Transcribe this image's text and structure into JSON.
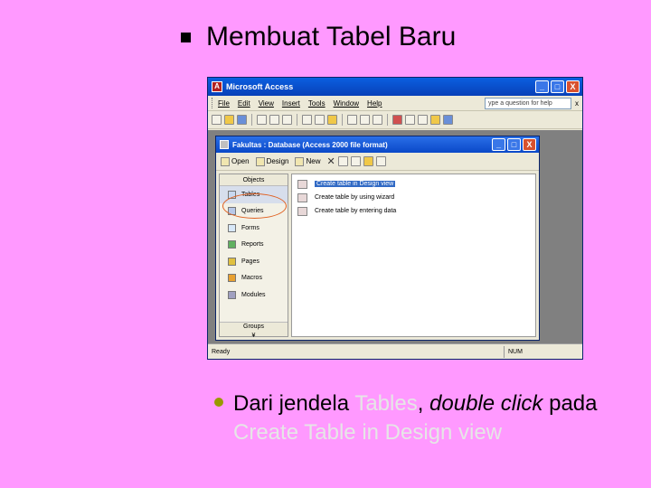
{
  "slide": {
    "title": "Membuat Tabel Baru",
    "bullet": {
      "part1": "Dari jendela ",
      "highlight1": "Tables",
      "part2": ", ",
      "italic": "double click",
      "part3": " pada ",
      "highlight2": "Create Table in Design view"
    }
  },
  "app": {
    "title": "Microsoft Access",
    "logo_letter": "A",
    "window_buttons": [
      "_",
      "□",
      "X"
    ],
    "menu": [
      "File",
      "Edit",
      "View",
      "Insert",
      "Tools",
      "Window",
      "Help"
    ],
    "help_placeholder": "ype a question for help",
    "menu_close": "x",
    "status_left": "Ready",
    "status_right": "NUM"
  },
  "db_window": {
    "title": "Fakultas : Database (Access 2000 file format)",
    "toolbar": {
      "open": "Open",
      "design": "Design",
      "new": "New"
    },
    "objects_header": "Objects",
    "objects": [
      {
        "label": "Tables",
        "color": "#C8D8F0"
      },
      {
        "label": "Queries",
        "color": "#B8C8E8"
      },
      {
        "label": "Forms",
        "color": "#D8E8F8"
      },
      {
        "label": "Reports",
        "color": "#60B060"
      },
      {
        "label": "Pages",
        "color": "#E0C040"
      },
      {
        "label": "Macros",
        "color": "#E8A030"
      },
      {
        "label": "Modules",
        "color": "#A0A0C0"
      }
    ],
    "groups_header": "Groups",
    "groups_arrow": "¥",
    "list": [
      "Create table in Design view",
      "Create table by using wizard",
      "Create table by entering data"
    ]
  },
  "colors": {
    "slide_bg": "#FF99FF",
    "bullet": "#999900",
    "muted_text": "#E6E6E6",
    "highlight_ring": "#E06020",
    "selection": "#316AC5"
  }
}
